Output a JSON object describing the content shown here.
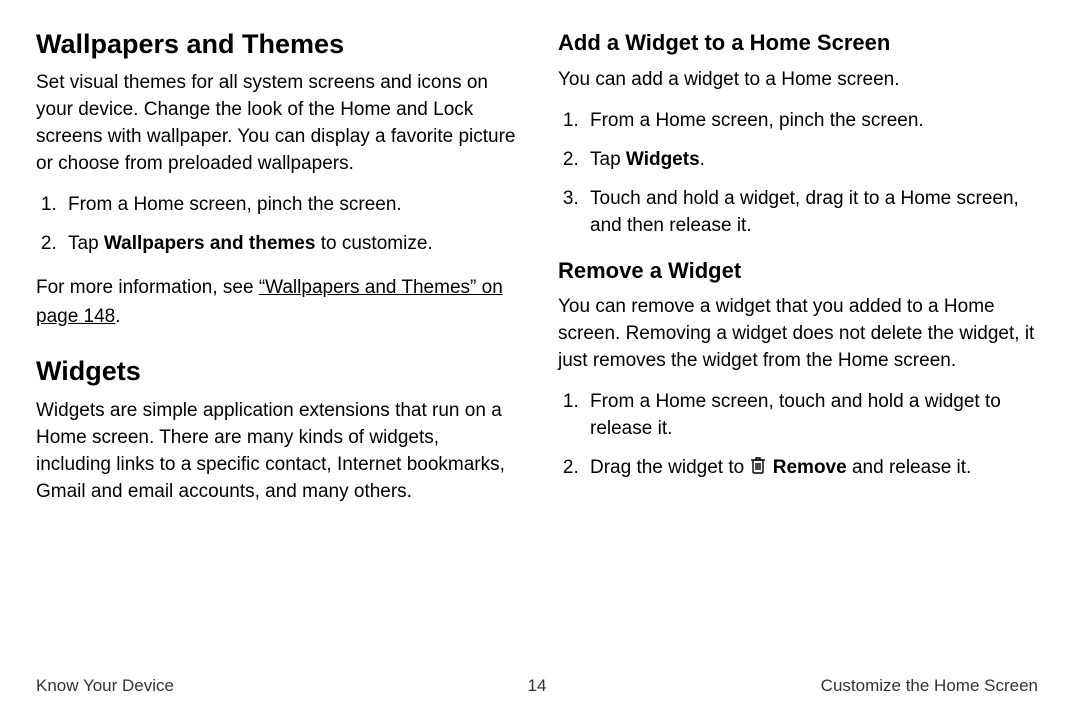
{
  "left": {
    "h_wallpapers": "Wallpapers and Themes",
    "wallpapers_intro": "Set visual themes for all system screens and icons on your device. Change the look of the Home and Lock screens with wallpaper. You can display a favorite picture or choose from preloaded wallpapers.",
    "wp_step1": "From a Home screen, pinch the screen.",
    "wp_step2_pre": "Tap ",
    "wp_step2_bold": "Wallpapers and themes",
    "wp_step2_post": " to customize.",
    "xref_pre": "For more information, see ",
    "xref_link": "“Wallpapers and Themes” on page 148",
    "xref_post": ".",
    "h_widgets": "Widgets",
    "widgets_intro": "Widgets are simple application extensions that run on a Home screen. There are many kinds of widgets, including links to a specific contact, Internet bookmarks, Gmail and email accounts, and many others."
  },
  "right": {
    "h_add": "Add a Widget to a Home Screen",
    "add_intro": "You can add a widget to a Home screen.",
    "add_step1": "From a Home screen, pinch the screen.",
    "add_step2_pre": "Tap ",
    "add_step2_bold": "Widgets",
    "add_step2_post": ".",
    "add_step3": "Touch and hold a widget, drag it to a Home screen, and then release it.",
    "h_remove": "Remove a Widget",
    "remove_intro": "You can remove a widget that you added to a Home screen. Removing a widget does not delete the widget, it just removes the widget from the Home screen.",
    "rm_step1": "From a Home screen, touch and hold a widget to release it.",
    "rm_step2_pre": "Drag the widget to ",
    "rm_step2_bold": "Remove",
    "rm_step2_post": " and release it."
  },
  "footer": {
    "left": "Know Your Device",
    "center": "14",
    "right": "Customize the Home Screen"
  }
}
